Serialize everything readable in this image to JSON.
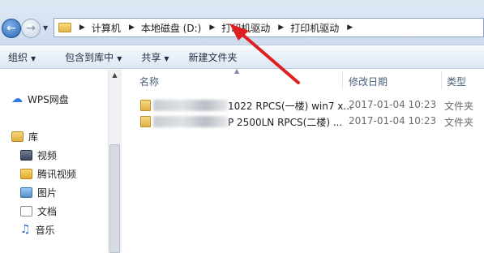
{
  "address_bar": {
    "crumbs": [
      "计算机",
      "本地磁盘 (D:)",
      "打印机驱动",
      "打印机驱动"
    ]
  },
  "toolbar": {
    "organize": "组织",
    "include_in_library": "包含到库中",
    "share": "共享",
    "new_folder": "新建文件夹"
  },
  "nav": {
    "wps_cloud": "WPS网盘",
    "library": "库",
    "video": "视频",
    "tencent_video": "腾讯视频",
    "pictures": "图片",
    "documents": "文档",
    "music": "音乐"
  },
  "columns": {
    "name": "名称",
    "modified": "修改日期",
    "type": "类型"
  },
  "files": [
    {
      "name_suffix": "1022 RPCS(一楼) win7 x...",
      "date": "2017-01-04  10:23",
      "type": "文件夹"
    },
    {
      "name_suffix": "P 2500LN RPCS(二楼) ...",
      "date": "2017-01-04  10:23",
      "type": "文件夹"
    }
  ],
  "colors": {
    "annotation_arrow": "#e02020",
    "toolbar_bg": "#dde7f3"
  }
}
